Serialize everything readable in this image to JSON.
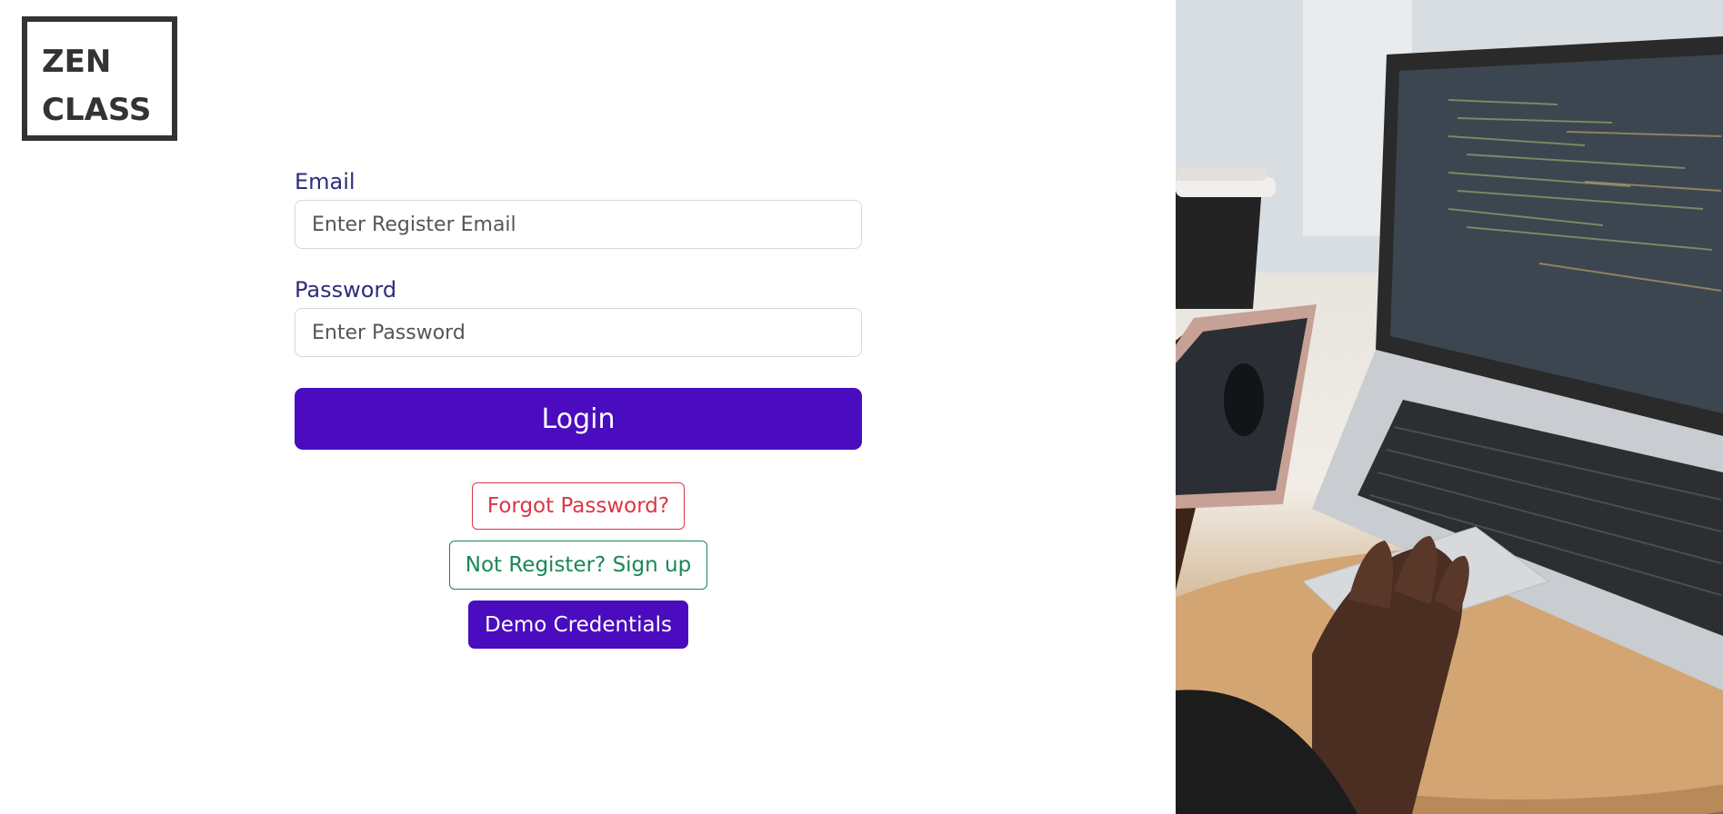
{
  "logo": {
    "line1": "ZEN",
    "line2": "CLASS"
  },
  "form": {
    "email_label": "Email",
    "email_placeholder": "Enter Register Email",
    "email_value": "",
    "password_label": "Password",
    "password_placeholder": "Enter Password",
    "password_value": "",
    "login_label": "Login"
  },
  "actions": {
    "forgot_label": "Forgot Password?",
    "signup_label": "Not Register? Sign up",
    "demo_label": "Demo Credentials"
  },
  "colors": {
    "primary": "#4a0cbe",
    "label": "#2e2d7a",
    "danger": "#dc3545",
    "success": "#198754"
  }
}
